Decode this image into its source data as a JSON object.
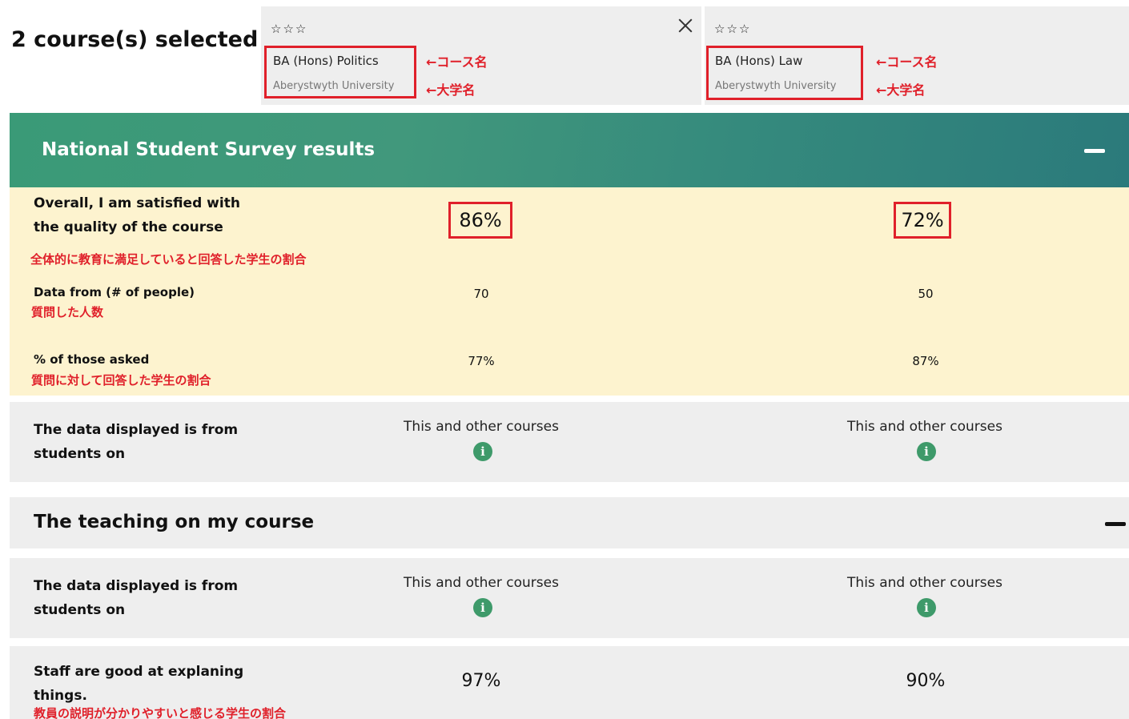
{
  "header": {
    "selected_count": "2 course(s) selected"
  },
  "courses": [
    {
      "stars": "☆☆☆",
      "name": "BA (Hons) Politics",
      "university": "Aberystwyth University"
    },
    {
      "stars": "☆☆☆",
      "name": "BA (Hons) Law",
      "university": "Aberystwyth University"
    }
  ],
  "annotations": {
    "course_name": "←コース名",
    "university_name": "←大学名"
  },
  "nss": {
    "title": "National Student Survey results",
    "overall": {
      "label": "Overall, I am satisfied with the quality of the course",
      "jp": "全体的に教育に満足していると回答した学生の割合",
      "values": [
        "86%",
        "72%"
      ]
    },
    "data_from": {
      "label": "Data from (# of people)",
      "jp": "質問した人数",
      "values": [
        "70",
        "50"
      ]
    },
    "asked": {
      "label": "% of those asked",
      "jp": "質問に対して回答した学生の割合",
      "values": [
        "77%",
        "87%"
      ]
    },
    "source": {
      "label": "The data displayed is from students on",
      "values": [
        "This and other courses",
        "This and other courses"
      ]
    }
  },
  "teaching": {
    "title": "The teaching on my course",
    "source": {
      "label": "The data displayed is from students on",
      "values": [
        "This and other courses",
        "This and other courses"
      ]
    },
    "staff": {
      "label": "Staff are good at explaning things.",
      "jp": "教員の説明が分かりやすいと感じる学生の割合",
      "values": [
        "97%",
        "90%"
      ]
    }
  },
  "icons": {
    "info": "info-icon",
    "close": "close-icon",
    "collapse": "minus-icon",
    "star": "star-outline-icon"
  },
  "colors": {
    "banner": "#3a9a77",
    "highlight": "#fdf3cf",
    "annotation_red": "#e0202a",
    "info_green": "#3e9a6a"
  }
}
